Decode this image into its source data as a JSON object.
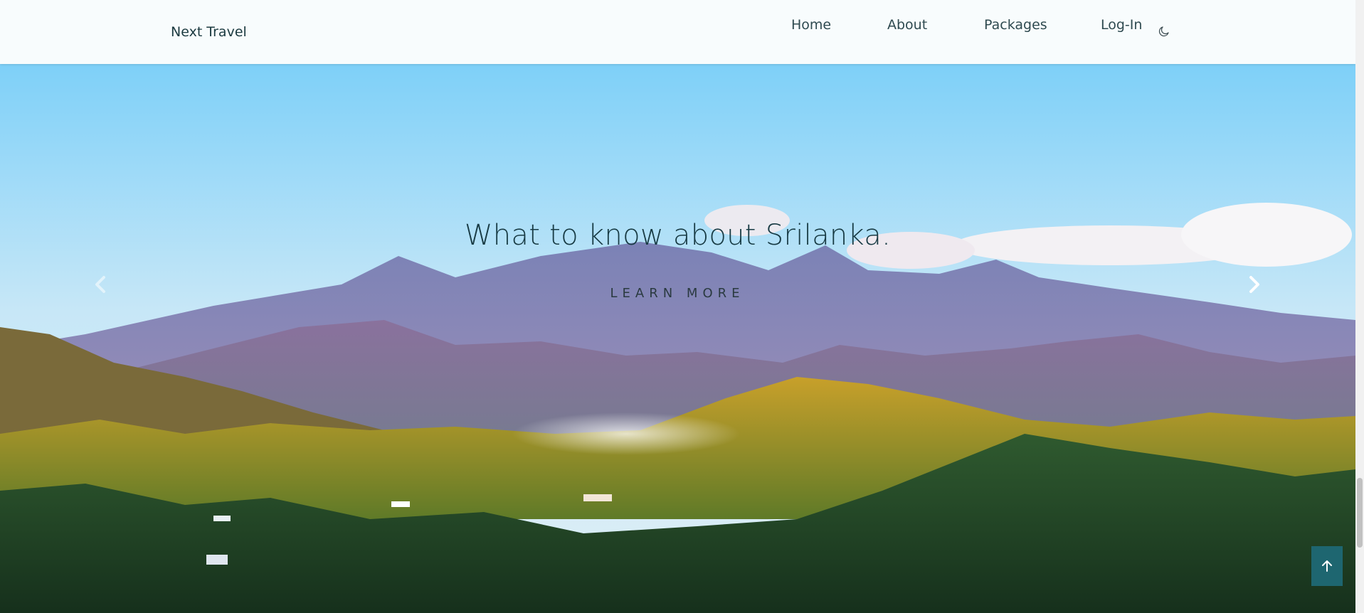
{
  "header": {
    "brand": "Next Travel",
    "nav": [
      {
        "label": "Home"
      },
      {
        "label": "About"
      },
      {
        "label": "Packages"
      },
      {
        "label": "Log-In"
      }
    ],
    "theme_toggle_icon": "moon-icon"
  },
  "hero": {
    "title": "What to know about Srilanka.",
    "cta_label": "LEARN MORE",
    "prev_icon": "chevron-left-icon",
    "next_icon": "chevron-right-icon"
  },
  "back_to_top_icon": "arrow-up-icon",
  "colors": {
    "accent": "#1e6670",
    "header_bg": "#f8fcfd",
    "title_text": "#173a43"
  }
}
